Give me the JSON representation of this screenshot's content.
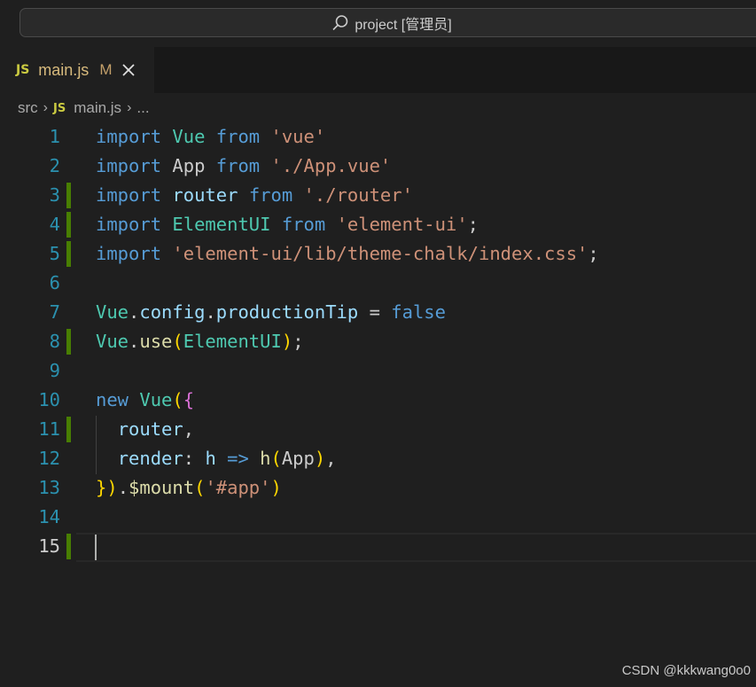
{
  "titlebar": {
    "search_text": "project [管理员]"
  },
  "tab": {
    "icon_label": "JS",
    "name": "main.js",
    "modified": "M"
  },
  "breadcrumb": {
    "folder": "src",
    "icon_label": "JS",
    "file": "main.js",
    "more": "..."
  },
  "editor": {
    "line_numbers": [
      "1",
      "2",
      "3",
      "4",
      "5",
      "6",
      "7",
      "8",
      "9",
      "10",
      "11",
      "12",
      "13",
      "14",
      "15"
    ],
    "lines": [
      "import Vue from 'vue'",
      "import App from './App.vue'",
      "import router from './router'",
      "import ElementUI from 'element-ui';",
      "import 'element-ui/lib/theme-chalk/index.css';",
      "",
      "Vue.config.productionTip = false",
      "Vue.use(ElementUI);",
      "",
      "new Vue({",
      "  router,",
      "  render: h => h(App),",
      "}).$mount('#app')",
      "",
      ""
    ],
    "modified_lines": [
      3,
      4,
      5,
      8,
      11,
      15
    ],
    "cursor_line": 15
  },
  "watermark": "CSDN @kkkwang0o0"
}
